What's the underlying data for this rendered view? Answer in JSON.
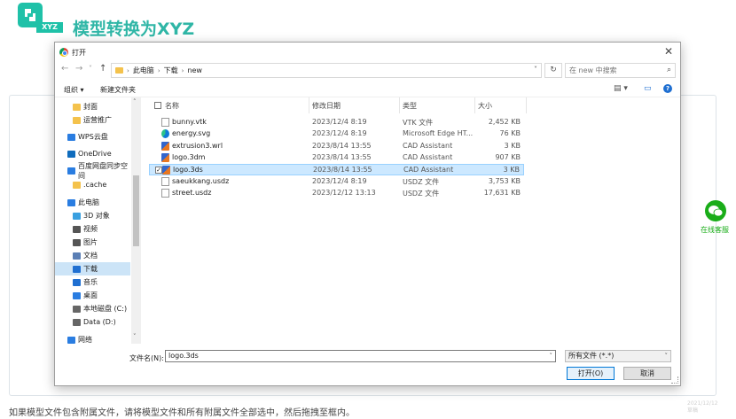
{
  "page": {
    "logo_tag": "XYZ",
    "title": "模型转换为XYZ",
    "bottom_text": "如果模型文件包含附属文件，请将模型文件和所有附属文件全部选中，然后拖拽至框内。",
    "wechat_label": "在线客服",
    "watermark_line1": "2021/12/12",
    "watermark_line2": "草稿"
  },
  "dialog": {
    "title": "打开",
    "close": "✕",
    "nav": {
      "back": "←",
      "forward": "→",
      "down": "˅",
      "up": "↑",
      "refresh": "↻"
    },
    "breadcrumb": [
      "此电脑",
      "下载",
      "new"
    ],
    "search_placeholder": "在 new 中搜索",
    "toolbar": {
      "organize": "组织 ▾",
      "new_folder": "新建文件夹",
      "view": "▤ ▾",
      "pane": "▭",
      "help": "?"
    },
    "sidebar": [
      {
        "label": "封面",
        "color": "#f4c24c"
      },
      {
        "label": "运营推广",
        "color": "#f4c24c"
      },
      {
        "label": "WPS云盘",
        "color": "#2a7de1"
      },
      {
        "label": "OneDrive",
        "color": "#0f6cbd"
      },
      {
        "label": "百度网盘同步空间",
        "color": "#2a7de1"
      },
      {
        "label": ".cache",
        "color": "#f4c24c"
      },
      {
        "label": "此电脑",
        "color": "#2a7de1"
      },
      {
        "label": "3D 对象",
        "color": "#3aa0e0"
      },
      {
        "label": "视频",
        "color": "#555555"
      },
      {
        "label": "图片",
        "color": "#555555"
      },
      {
        "label": "文档",
        "color": "#5b7fb5"
      },
      {
        "label": "下载",
        "color": "#1f6fd1"
      },
      {
        "label": "音乐",
        "color": "#1f6fd1"
      },
      {
        "label": "桌面",
        "color": "#2a7de1"
      },
      {
        "label": "本地磁盘 (C:)",
        "color": "#666666"
      },
      {
        "label": "Data (D:)",
        "color": "#666666"
      },
      {
        "label": "网络",
        "color": "#2a7de1"
      }
    ],
    "columns": {
      "name": "名称",
      "date": "修改日期",
      "type": "类型",
      "size": "大小"
    },
    "files": [
      {
        "name": "bunny.vtk",
        "date": "2023/12/4 8:19",
        "type": "VTK 文件",
        "size": "2,452 KB",
        "icon": "doc"
      },
      {
        "name": "energy.svg",
        "date": "2023/12/4 8:19",
        "type": "Microsoft Edge HT...",
        "size": "76 KB",
        "icon": "edge"
      },
      {
        "name": "extrusion3.wrl",
        "date": "2023/8/14 13:55",
        "type": "CAD Assistant",
        "size": "3 KB",
        "icon": "cad"
      },
      {
        "name": "logo.3dm",
        "date": "2023/8/14 13:55",
        "type": "CAD Assistant",
        "size": "907 KB",
        "icon": "cad"
      },
      {
        "name": "logo.3ds",
        "date": "2023/8/14 13:55",
        "type": "CAD Assistant",
        "size": "3 KB",
        "icon": "cad",
        "selected": true,
        "check": "✓"
      },
      {
        "name": "saeukkang.usdz",
        "date": "2023/12/4 8:19",
        "type": "USDZ 文件",
        "size": "3,753 KB",
        "icon": "doc"
      },
      {
        "name": "street.usdz",
        "date": "2023/12/12 13:13",
        "type": "USDZ 文件",
        "size": "17,631 KB",
        "icon": "doc"
      }
    ],
    "filename_label": "文件名(N):",
    "filename_value": "logo.3ds",
    "filter_value": "所有文件 (*.*)",
    "open_button": "打开(O)",
    "cancel_button": "取消",
    "dropdown_arrow": "˅",
    "search_icon": "⌕",
    "sep": "›",
    "scroll_up": "˄",
    "scroll_down": "˅"
  }
}
